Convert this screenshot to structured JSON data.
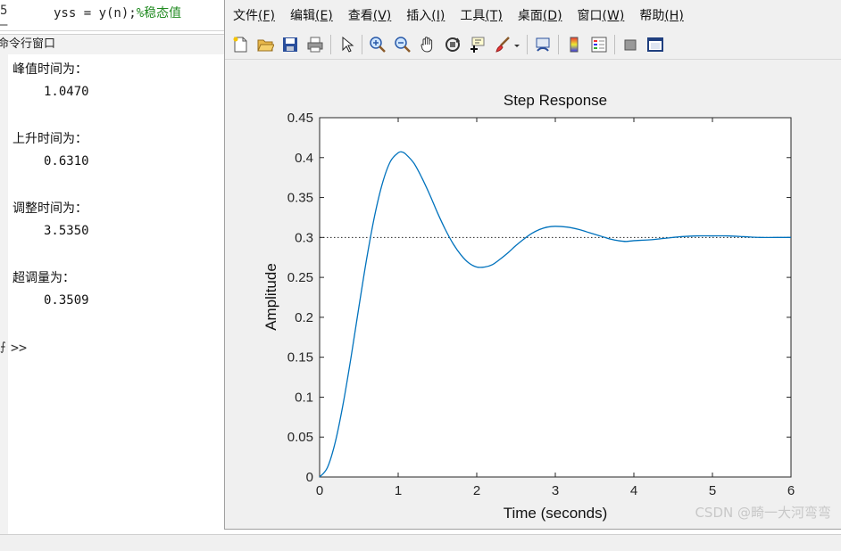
{
  "editor": {
    "line_number": "5 –",
    "code": "yss = y(n);",
    "comment": "%稳态值"
  },
  "command_window": {
    "title": "命令行窗口",
    "outputs": [
      {
        "label": "峰值时间为：",
        "value": "1.0470"
      },
      {
        "label": "上升时间为：",
        "value": "0.6310"
      },
      {
        "label": "调整时间为：",
        "value": "3.5350"
      },
      {
        "label": "超调量为：",
        "value": "0.3509"
      }
    ],
    "prompt": ">>",
    "edge_glyph": "⨍"
  },
  "figure": {
    "menu": [
      {
        "label": "文件",
        "key": "(F)"
      },
      {
        "label": "编辑",
        "key": "(E)"
      },
      {
        "label": "查看",
        "key": "(V)"
      },
      {
        "label": "插入",
        "key": "(I)"
      },
      {
        "label": "工具",
        "key": "(T)"
      },
      {
        "label": "桌面",
        "key": "(D)"
      },
      {
        "label": "窗口",
        "key": "(W)"
      },
      {
        "label": "帮助",
        "key": "(H)"
      }
    ],
    "toolbar_icons": [
      "new-figure-icon",
      "open-file-icon",
      "save-icon",
      "print-icon",
      "select-pointer-icon",
      "zoom-in-icon",
      "zoom-out-icon",
      "pan-hand-icon",
      "rotate-3d-icon",
      "data-cursor-icon",
      "brush-icon",
      "brush-dropdown-icon",
      "link-plot-icon",
      "colorbar-icon",
      "legend-icon",
      "hide-plot-tools-icon",
      "show-plot-tools-icon"
    ]
  },
  "chart_data": {
    "type": "line",
    "title": "Step Response",
    "xlabel": "Time (seconds)",
    "ylabel": "Amplitude",
    "xlim": [
      0,
      6
    ],
    "ylim": [
      0,
      0.45
    ],
    "xticks": [
      "0",
      "1",
      "2",
      "3",
      "4",
      "5",
      "6"
    ],
    "yticks": [
      "0",
      "0.05",
      "0.1",
      "0.15",
      "0.2",
      "0.25",
      "0.3",
      "0.35",
      "0.4",
      "0.45"
    ],
    "grid": false,
    "steady_state": 0.3,
    "steady_state_style": "dotted",
    "line_color": "#0072bd",
    "series": [
      {
        "x": [
          0,
          0.1,
          0.2,
          0.3,
          0.4,
          0.5,
          0.6,
          0.7,
          0.8,
          0.9,
          1.0,
          1.05,
          1.1,
          1.2,
          1.3,
          1.4,
          1.5,
          1.6,
          1.7,
          1.8,
          1.9,
          2.0,
          2.1,
          2.2,
          2.3,
          2.4,
          2.5,
          2.6,
          2.7,
          2.8,
          2.9,
          3.0,
          3.15,
          3.3,
          3.4,
          3.5,
          3.6,
          3.7,
          3.8,
          3.9,
          4.0,
          4.2,
          4.4,
          4.6,
          4.8,
          5.0,
          5.2,
          5.4,
          5.6,
          5.8,
          6.0
        ],
        "y": [
          0,
          0.012,
          0.044,
          0.092,
          0.15,
          0.213,
          0.274,
          0.327,
          0.368,
          0.395,
          0.406,
          0.407,
          0.404,
          0.393,
          0.375,
          0.354,
          0.331,
          0.31,
          0.292,
          0.278,
          0.268,
          0.263,
          0.263,
          0.266,
          0.273,
          0.281,
          0.29,
          0.298,
          0.305,
          0.31,
          0.313,
          0.314,
          0.313,
          0.31,
          0.307,
          0.304,
          0.301,
          0.298,
          0.296,
          0.295,
          0.296,
          0.297,
          0.299,
          0.301,
          0.302,
          0.302,
          0.302,
          0.301,
          0.3,
          0.3,
          0.3
        ]
      }
    ]
  },
  "watermark": "CSDN @畸一大河弯弯"
}
